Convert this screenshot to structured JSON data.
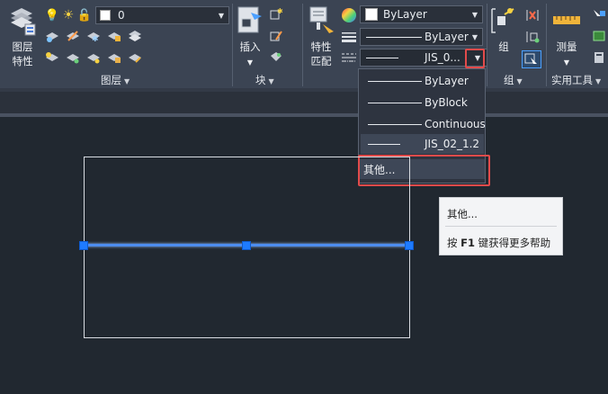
{
  "ribbon": {
    "layers_panel": {
      "button_label_line1": "图层",
      "button_label_line2": "特性",
      "layer_value": "0",
      "panel_label": "图层"
    },
    "block_panel": {
      "insert_label": "插入",
      "panel_label": "块"
    },
    "properties_panel": {
      "match_label_line1": "特性",
      "match_label_line2": "匹配",
      "color_value": "ByLayer",
      "lineweight_value": "ByLayer",
      "linetype_value": "JIS_0..."
    },
    "group_panel": {
      "group_label": "组",
      "panel_label": "组"
    },
    "utilities_panel": {
      "measure_label": "测量",
      "panel_label": "实用工具"
    }
  },
  "linetype_menu": {
    "items": [
      {
        "label": "ByLayer"
      },
      {
        "label": "ByBlock"
      },
      {
        "label": "Continuous"
      },
      {
        "label": "JIS_02_1.2"
      }
    ],
    "other_label": "其他..."
  },
  "tooltip": {
    "title": "其他...",
    "help_prefix": "按 ",
    "help_key": "F1",
    "help_suffix": " 键获得更多帮助"
  },
  "colors": {
    "ribbon_bg": "#3b4453",
    "canvas_bg": "#212830",
    "selection_blue": "#1e7bff",
    "highlight_red": "#e24b4b"
  }
}
